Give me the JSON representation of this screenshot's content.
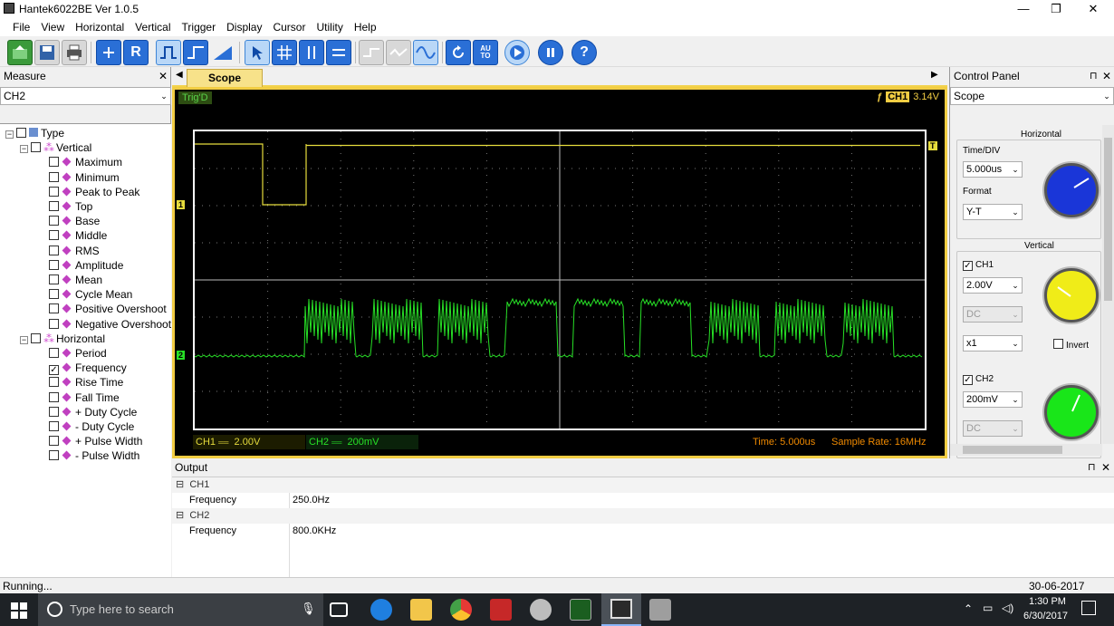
{
  "window": {
    "title": "Hantek6022BE Ver 1.0.5",
    "min": "—",
    "max": "❐",
    "close": "✕"
  },
  "menu": [
    "File",
    "View",
    "Horizontal",
    "Vertical",
    "Trigger",
    "Display",
    "Cursor",
    "Utility",
    "Help"
  ],
  "measure": {
    "title": "Measure",
    "close": "✕",
    "channel": "CH2",
    "tree": {
      "root": "Type",
      "vertical_label": "Vertical",
      "vertical": [
        "Maximum",
        "Minimum",
        "Peak to Peak",
        "Top",
        "Base",
        "Middle",
        "RMS",
        "Amplitude",
        "Mean",
        "Cycle Mean",
        "Positive Overshoot",
        "Negative Overshoot"
      ],
      "horizontal_label": "Horizontal",
      "horizontal": [
        "Period",
        "Frequency",
        "Rise Time",
        "Fall Time",
        "+ Duty Cycle",
        "- Duty Cycle",
        "+ Pulse Width",
        "- Pulse Width"
      ],
      "checked": "Frequency"
    }
  },
  "scope": {
    "tab": "Scope",
    "status": "Trig'D",
    "trigger_channel": "CH1",
    "trigger_level": "3.14V",
    "ch1_marker": "1",
    "ch2_marker": "2",
    "trigger_marker": "T",
    "ch1_label": "CH1",
    "ch1_scale": "2.00V",
    "ch2_label": "CH2",
    "ch2_scale": "200mV",
    "time_label": "Time: 5.000us",
    "sample_label": "Sample Rate: 16MHz",
    "ch1_color": "#e6dc3c",
    "ch2_color": "#27e026"
  },
  "output": {
    "title": "Output",
    "groups": [
      {
        "name": "CH1",
        "rows": [
          {
            "label": "Frequency",
            "value": "250.0Hz"
          }
        ]
      },
      {
        "name": "CH2",
        "rows": [
          {
            "label": "Frequency",
            "value": "800.0KHz"
          }
        ]
      }
    ]
  },
  "control_panel": {
    "title": "Control Panel",
    "mode": "Scope",
    "horizontal_title": "Horizontal",
    "timediv_label": "Time/DIV",
    "timediv": "5.000us",
    "format_label": "Format",
    "format": "Y-T",
    "vertical_title": "Vertical",
    "ch1_label": "CH1",
    "ch1_volt": "2.00V",
    "ch1_coupling": "DC",
    "ch1_probe": "x1",
    "invert_label": "Invert",
    "ch2_label": "CH2",
    "ch2_volt": "200mV",
    "ch2_coupling": "DC"
  },
  "status": {
    "text": "Running...",
    "datetime": "30-06-2017  13:30"
  },
  "taskbar": {
    "search_placeholder": "Type here to search",
    "time": "1:30 PM",
    "date": "6/30/2017"
  }
}
